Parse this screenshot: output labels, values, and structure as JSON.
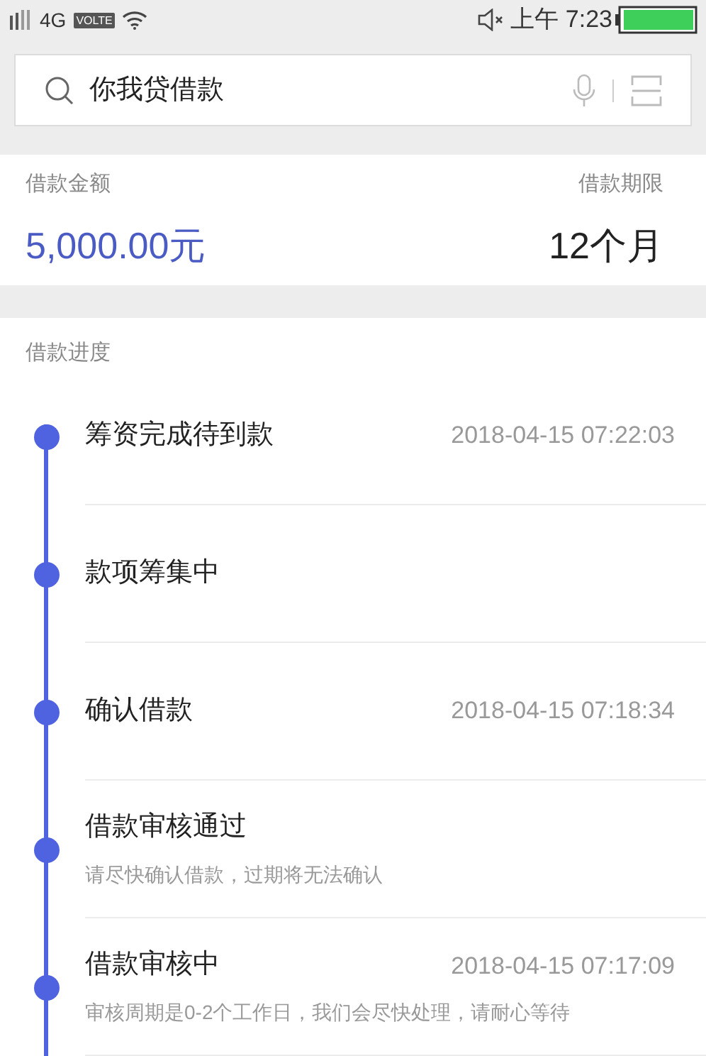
{
  "status_bar": {
    "network": "4G",
    "volte": "VOLTE",
    "time": "上午 7:23"
  },
  "search": {
    "value": "你我贷借款"
  },
  "loan": {
    "amount_label": "借款金额",
    "amount": "5,000.00元",
    "term_label": "借款期限",
    "term": "12个月"
  },
  "progress": {
    "title": "借款进度",
    "steps": [
      {
        "title": "筹资完成待到款",
        "time": "2018-04-15 07:22:03"
      },
      {
        "title": "款项筹集中"
      },
      {
        "title": "确认借款",
        "time": "2018-04-15 07:18:34"
      },
      {
        "title": "借款审核通过",
        "note": "请尽快确认借款，过期将无法确认"
      },
      {
        "title": "借款审核中",
        "time": "2018-04-15 07:17:09",
        "note": "审核周期是0-2个工作日，我们会尽快处理，请耐心等待"
      }
    ]
  }
}
